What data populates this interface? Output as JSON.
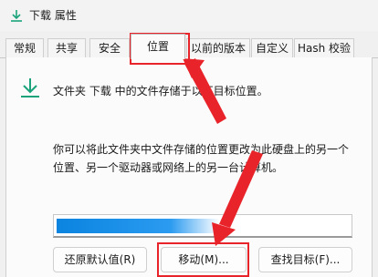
{
  "window": {
    "title": "下载 属性",
    "icon": "download-folder-icon"
  },
  "tabs": [
    {
      "label": "常规",
      "active": false
    },
    {
      "label": "共享",
      "active": false
    },
    {
      "label": "安全",
      "active": false
    },
    {
      "label": "位置",
      "active": true
    },
    {
      "label": "以前的版本",
      "active": false
    },
    {
      "label": "自定义",
      "active": false
    },
    {
      "label": "Hash 校验",
      "active": false
    }
  ],
  "location": {
    "icon": "download-arrow-icon",
    "description": "文件夹 下载 中的文件存储于以下目标位置。",
    "info_line1": "你可以将此文件夹中文件存储的位置更改为此硬盘上的另一个",
    "info_line2": "位置、另一个驱动器或网络上的另一台计算机。",
    "path_value": ""
  },
  "buttons": {
    "restore_default": "还原默认值(R)",
    "move": "移动(M)...",
    "find_target": "查找目标(F)..."
  },
  "colors": {
    "highlight": "#e8232a",
    "accent_icon": "#1aa37a",
    "selection": "#0a84e0"
  }
}
